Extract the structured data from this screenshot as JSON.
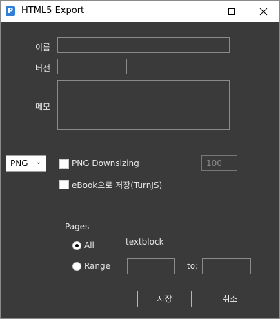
{
  "window": {
    "title": "HTML5 Export",
    "app_icon_glyph": "P"
  },
  "form": {
    "name_label": "이름",
    "name_value": "",
    "version_label": "버전",
    "version_value": "",
    "memo_label": "메모",
    "memo_value": ""
  },
  "format": {
    "selected": "PNG",
    "png_downsizing_label": "PNG Downsizing",
    "png_downsizing_checked": false,
    "downsizing_value": "100",
    "ebook_label": "eBook으로 저장(TurnJS)",
    "ebook_checked": false
  },
  "pages": {
    "group_label": "Pages",
    "all_label": "All",
    "all_selected": true,
    "textblock": "textblock",
    "range_label": "Range",
    "range_from": "",
    "to_label": "to:",
    "range_to": ""
  },
  "buttons": {
    "save": "저장",
    "cancel": "취소"
  },
  "icons": {
    "app": "html5-export-app-icon",
    "minimize": "minimize-icon",
    "maximize": "maximize-icon",
    "close": "close-icon",
    "dropdown": "chevron-down-icon"
  }
}
